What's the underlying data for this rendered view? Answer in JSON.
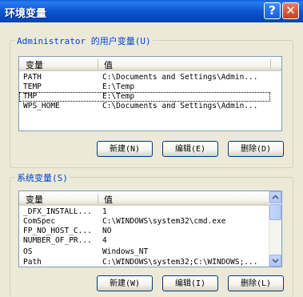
{
  "window": {
    "title": "环境变量"
  },
  "title_buttons": {
    "help": "?",
    "close": "✕"
  },
  "user_group": {
    "label": "Administrator 的用户变量(U)",
    "columns": [
      "变量",
      "值"
    ],
    "rows": [
      {
        "name": "PATH",
        "value": "C:\\Documents and Settings\\Admin..."
      },
      {
        "name": "TEMP",
        "value": "E:\\Temp"
      },
      {
        "name": "TMP",
        "value": "E:\\Temp"
      },
      {
        "name": "WPS_HOME",
        "value": "C:\\Documents and Settings\\Admin..."
      }
    ],
    "buttons": {
      "new": "新建(N)",
      "edit": "编辑(E)",
      "delete": "删除(D)"
    }
  },
  "system_group": {
    "label": "系统变量(S)",
    "columns": [
      "变量",
      "值"
    ],
    "rows": [
      {
        "name": "_DFX_INSTALL...",
        "value": "1"
      },
      {
        "name": "ComSpec",
        "value": "C:\\WINDOWS\\system32\\cmd.exe"
      },
      {
        "name": "FP_NO_HOST_C...",
        "value": "NO"
      },
      {
        "name": "NUMBER_OF_PR...",
        "value": "4"
      },
      {
        "name": "OS",
        "value": "Windows_NT"
      },
      {
        "name": "Path",
        "value": "C:\\WINDOWS\\system32;C:\\WINDOWS;..."
      }
    ],
    "buttons": {
      "new": "新建(W)",
      "edit": "编辑(I)",
      "delete": "删除(L)"
    }
  }
}
